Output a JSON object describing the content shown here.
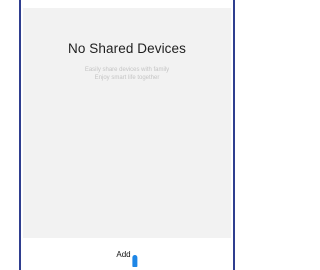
{
  "empty_state": {
    "title": "No Shared Devices",
    "subtitle_line1": "Easily share devices with family",
    "subtitle_line2": "Enjoy smart life together"
  },
  "bottom_bar": {
    "add_label": "Add"
  },
  "colors": {
    "frame_border": "#2f3e8f",
    "content_bg": "#f2f2f2",
    "subtitle_text": "#c4c4c4",
    "touch_indicator": "#1e86e6"
  }
}
